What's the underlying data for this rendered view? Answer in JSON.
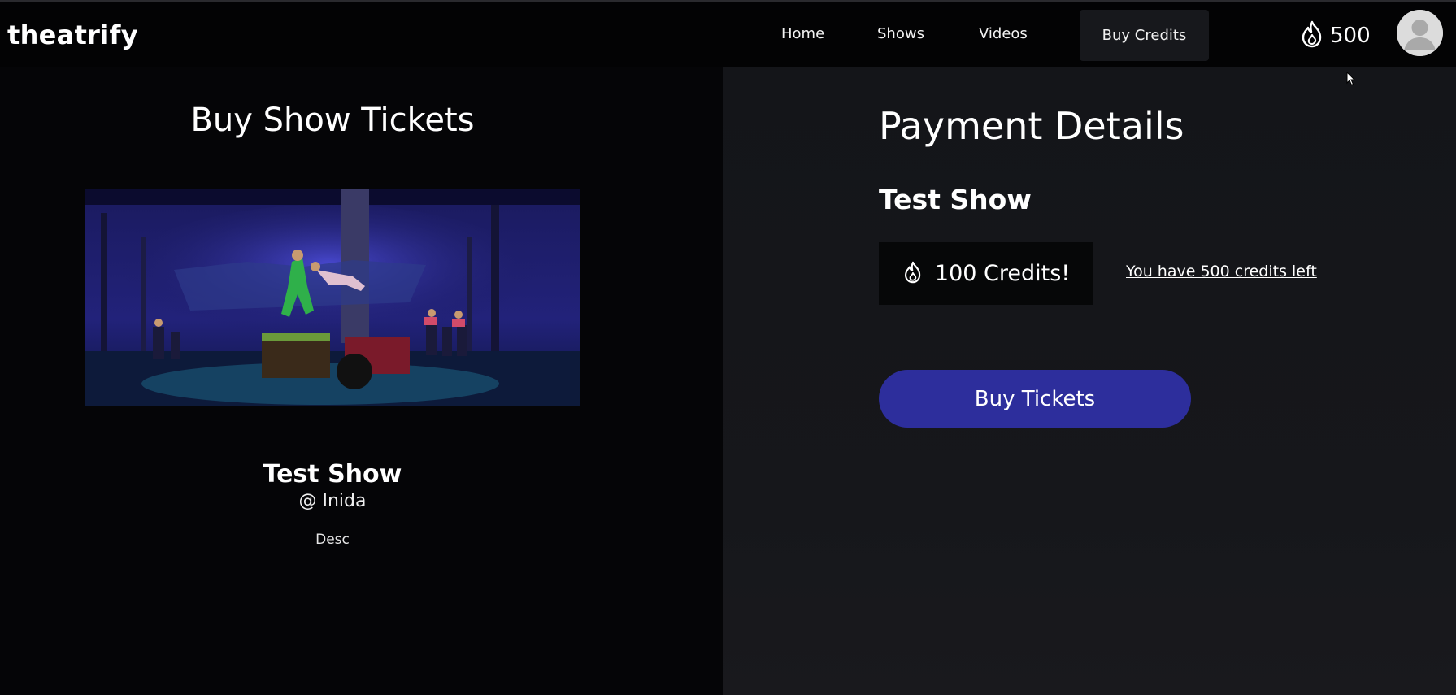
{
  "header": {
    "logo": "theatrify",
    "nav": {
      "home": "Home",
      "shows": "Shows",
      "videos": "Videos",
      "buy_credits": "Buy Credits"
    },
    "credits": "500",
    "credits_icon": "flame-icon",
    "avatar_icon": "user-avatar-icon"
  },
  "left": {
    "title": "Buy Show Tickets",
    "show_name": "Test Show",
    "location": "@ Inida",
    "description": "Desc"
  },
  "payment": {
    "title": "Payment Details",
    "show_name": "Test Show",
    "price_label": "100 Credits!",
    "price_icon": "flame-icon",
    "credits_left": "You have 500 credits left",
    "buy_button": "Buy Tickets"
  },
  "colors": {
    "background": "#050507",
    "panel": "#141519",
    "button": "#2d2e9c"
  }
}
